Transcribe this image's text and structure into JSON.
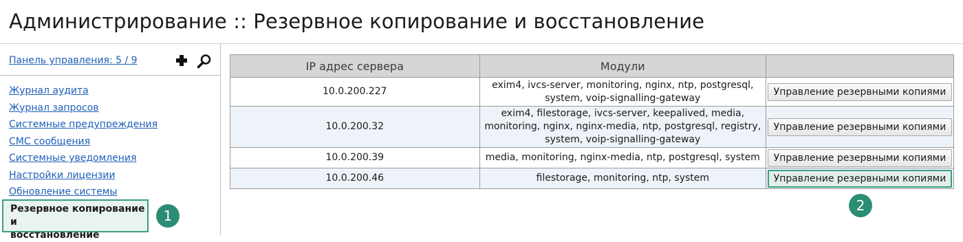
{
  "header": {
    "title": "Администрирование :: Резервное копирование и восстановление"
  },
  "sidebar": {
    "panel_link": "Панель управления: 5 / 9",
    "add_icon": "plus-icon",
    "search_icon": "magnifier-icon",
    "items": [
      {
        "label": "Журнал аудита"
      },
      {
        "label": "Журнал запросов"
      },
      {
        "label": "Системные предупреждения"
      },
      {
        "label": "СМС сообщения"
      },
      {
        "label": "Системные уведомления"
      },
      {
        "label": "Настройки лицензии"
      },
      {
        "label": "Обновление системы"
      }
    ],
    "active_item": {
      "label_line1": "Резервное копирование и",
      "label_line2": "восстановление"
    }
  },
  "table": {
    "headers": [
      "IP адрес сервера",
      "Модули",
      ""
    ],
    "rows": [
      {
        "ip": "10.0.200.227",
        "modules": [
          "exim4, ivcs-server, monitoring, nginx, ntp, postgresql,",
          "system, voip-signalling-gateway"
        ],
        "action": "Управление резервными копиями"
      },
      {
        "ip": "10.0.200.32",
        "modules": [
          "exim4, filestorage, ivcs-server, keepalived, media,",
          "monitoring, nginx, nginx-media, ntp, postgresql, registry,",
          "system, voip-signalling-gateway"
        ],
        "action": "Управление резервными копиями"
      },
      {
        "ip": "10.0.200.39",
        "modules": [
          "media, monitoring, nginx-media, ntp, postgresql, system"
        ],
        "action": "Управление резервными копиями"
      },
      {
        "ip": "10.0.200.46",
        "modules": [
          "filestorage, monitoring, ntp, system"
        ],
        "action": "Управление резервными копиями"
      }
    ]
  },
  "callouts": {
    "one": "1",
    "two": "2"
  },
  "colors": {
    "accent": "#2b8d73",
    "link": "#1f5fb8",
    "header_bg": "#d6d6d6",
    "row_alt": "#edf3f8"
  }
}
